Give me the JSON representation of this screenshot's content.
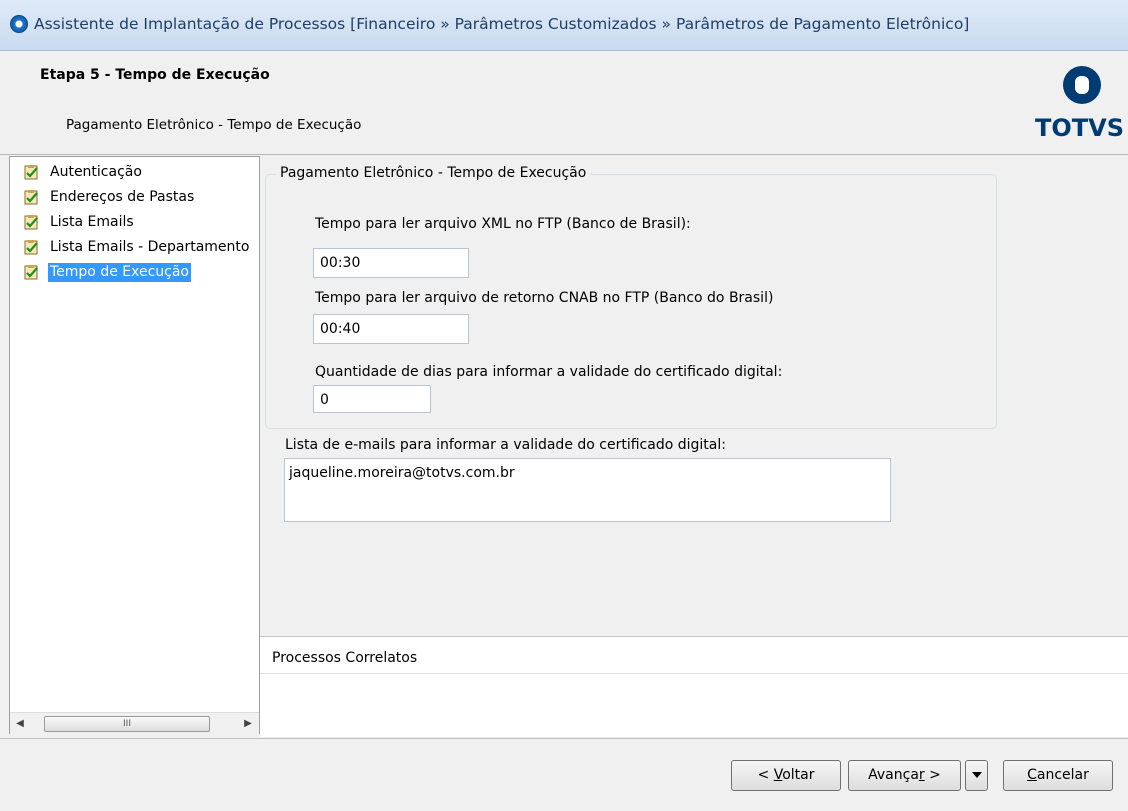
{
  "window": {
    "title": "Assistente de Implantação de Processos [Financeiro » Parâmetros Customizados  » Parâmetros de Pagamento Eletrônico]"
  },
  "header": {
    "step_title": "Etapa 5 - Tempo de Execução",
    "subtitle": "Pagamento Eletrônico - Tempo de Execução",
    "logo_text": "TOTVS"
  },
  "tree": {
    "items": [
      {
        "label": "Autenticação"
      },
      {
        "label": "Endereços de Pastas"
      },
      {
        "label": "Lista Emails"
      },
      {
        "label": "Lista Emails - Departamento"
      },
      {
        "label": "Tempo de Execução",
        "selected": true
      }
    ],
    "scroll_thumb_glyph": "III"
  },
  "form": {
    "group_title": "Pagamento Eletrônico - Tempo de Execução",
    "xml_label": "Tempo para ler arquivo XML no FTP (Banco de Brasil):",
    "xml_value": "00:30",
    "cnab_label": "Tempo para ler arquivo de retorno CNAB no FTP (Banco do Brasil)",
    "cnab_value": "00:40",
    "days_label": "Quantidade de dias para informar a validade do certificado digital:",
    "days_value": "0",
    "emails_label": "Lista de e-mails para informar a validade do certificado digital:",
    "emails_value": "jaqueline.moreira@totvs.com.br"
  },
  "related": {
    "title": "Processos Correlatos"
  },
  "buttons": {
    "back": {
      "prefix": "< ",
      "accel": "V",
      "rest": "oltar"
    },
    "next": {
      "prefix": "Avança",
      "accel": "r",
      "rest": " >"
    },
    "cancel": {
      "prefix": "",
      "accel": "C",
      "rest": "ancelar"
    }
  }
}
